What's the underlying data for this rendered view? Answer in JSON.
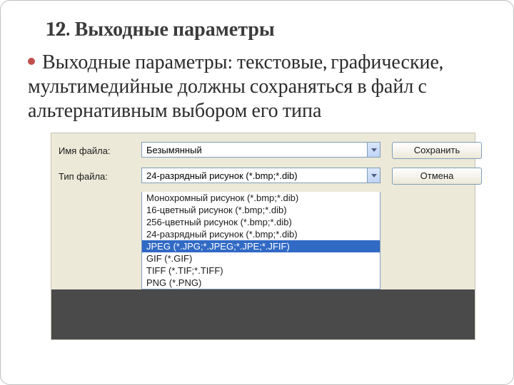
{
  "title": "12. Выходные параметры",
  "body": "Выходные параметры:  текстовые, графические, мультимедийные должны сохраняться в файл с альтернативным выбором его типа",
  "dialog": {
    "filename_label": "Имя файла:",
    "filetype_label": "Тип файла:",
    "filename_value": "Безымянный",
    "filetype_value": "24-разрядный рисунок (*.bmp;*.dib)",
    "save_label": "Сохранить",
    "cancel_label": "Отмена",
    "options": [
      "Монохромный рисунок (*.bmp;*.dib)",
      "16-цветный рисунок (*.bmp;*.dib)",
      "256-цветный рисунок (*.bmp;*.dib)",
      "24-разрядный рисунок (*.bmp;*.dib)",
      "JPEG (*.JPG;*.JPEG;*.JPE;*.JFIF)",
      "GIF (*.GIF)",
      "TIFF (*.TIF;*.TIFF)",
      "PNG (*.PNG)"
    ],
    "selected_index": 4
  }
}
